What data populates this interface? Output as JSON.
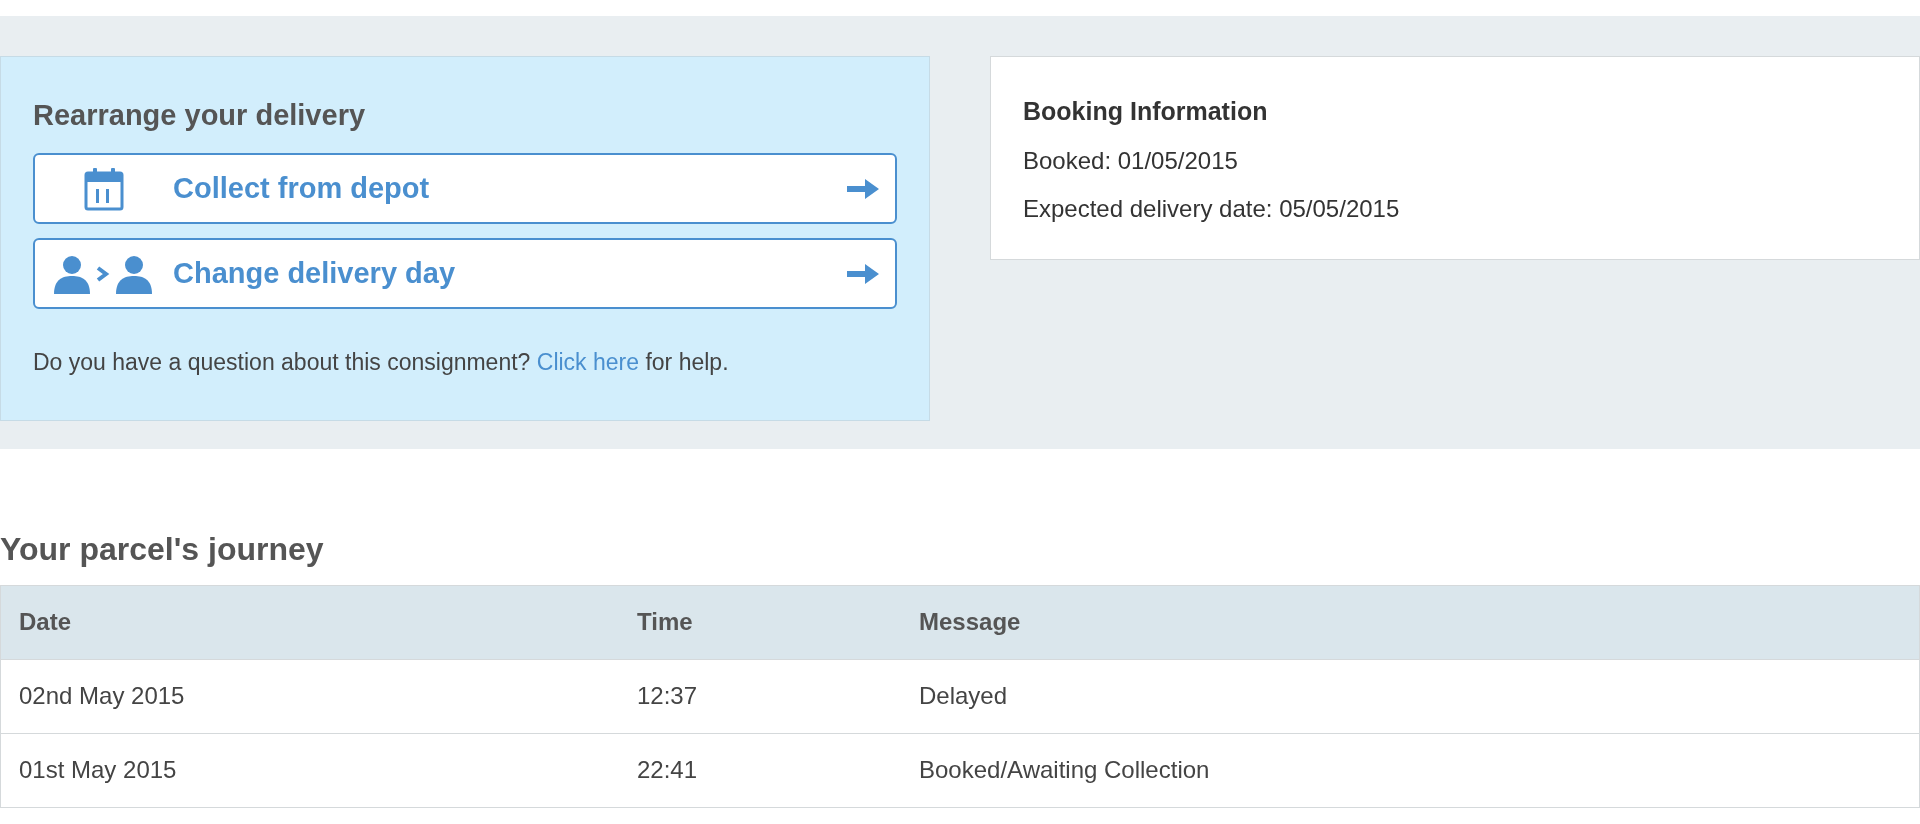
{
  "rearrange": {
    "title": "Rearrange your delivery",
    "actions": [
      {
        "kind": "calendar",
        "label": "Collect from depot"
      },
      {
        "kind": "people",
        "label": "Change delivery day"
      }
    ],
    "help": {
      "before": "Do you have a question about this consignment?",
      "link": "Click here",
      "after": "for help."
    }
  },
  "booking": {
    "title": "Booking Information",
    "lines": [
      "Booked: 01/05/2015",
      "Expected delivery date: 05/05/2015"
    ]
  },
  "journey": {
    "title": "Your parcel's journey",
    "columns": [
      "Date",
      "Time",
      "Message"
    ],
    "rows": [
      [
        "02nd May 2015",
        "12:37",
        "Delayed"
      ],
      [
        "01st May 2015",
        "22:41",
        "Booked/Awaiting Collection"
      ]
    ]
  }
}
